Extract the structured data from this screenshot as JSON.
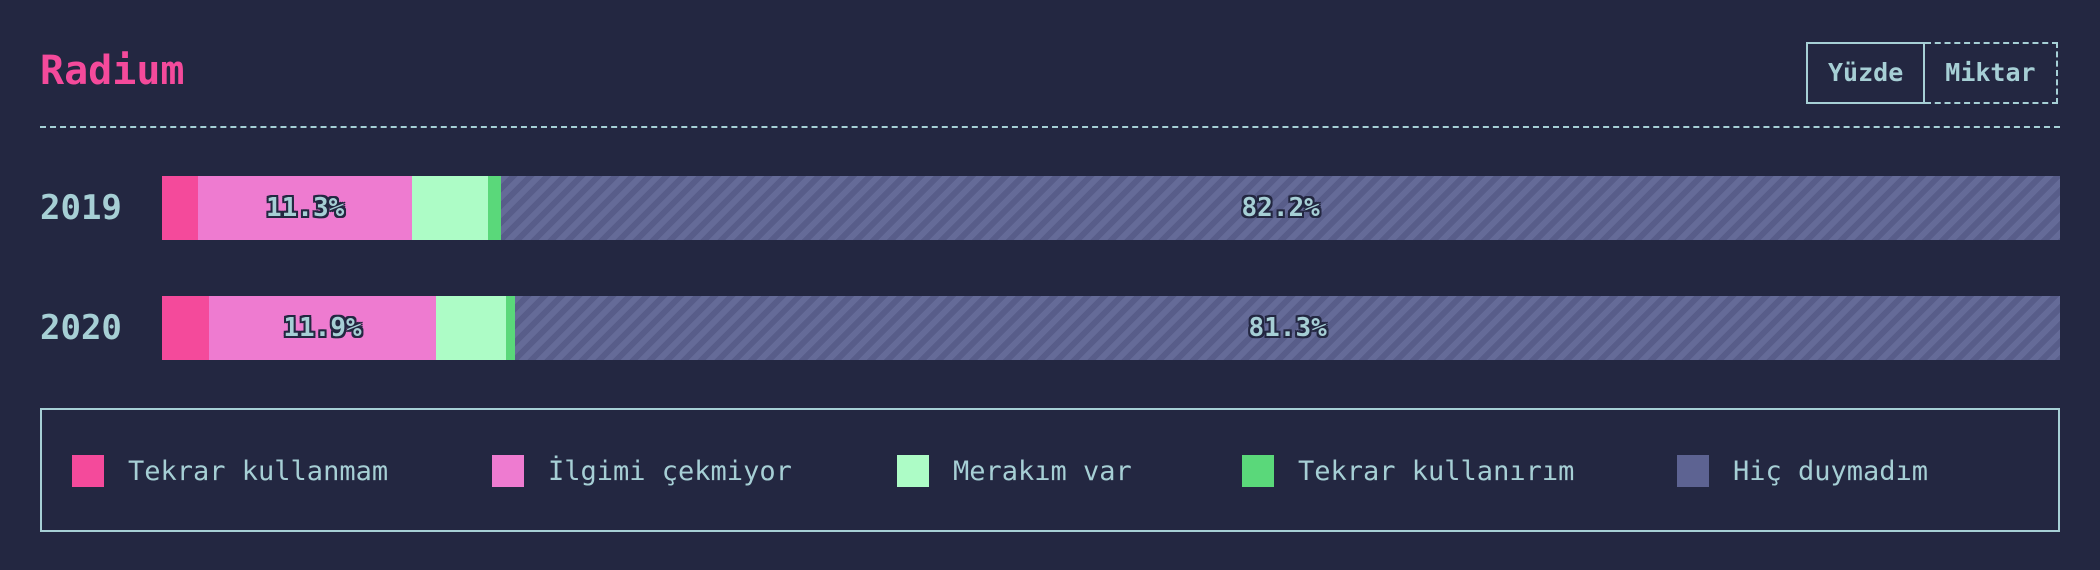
{
  "header": {
    "title": "Radium",
    "toggle": {
      "percent_label": "Yüzde",
      "amount_label": "Miktar"
    }
  },
  "colors": {
    "background": "#232741",
    "text": "#a6cfd5",
    "title": "#f44a9b"
  },
  "chart_data": {
    "type": "bar",
    "orientation": "horizontal",
    "stacked": true,
    "normalized": true,
    "categories": [
      "2019",
      "2020"
    ],
    "series": [
      {
        "name": "Tekrar kullanmam",
        "color": "#f44a9b",
        "values": [
          1.9,
          2.5
        ]
      },
      {
        "name": "İlgimi çekmiyor",
        "color": "#ee7bd0",
        "values": [
          11.3,
          11.9
        ]
      },
      {
        "name": "Merakım var",
        "color": "#adfcc6",
        "values": [
          4.0,
          3.7
        ]
      },
      {
        "name": "Tekrar kullanırım",
        "color": "#5ad87a",
        "values": [
          0.7,
          0.5
        ]
      },
      {
        "name": "Hiç duymadım",
        "color": "#5d6392",
        "values": [
          82.2,
          81.3
        ]
      }
    ],
    "value_labels": [
      [
        "",
        "11.3%",
        "",
        "",
        "82.2%"
      ],
      [
        "",
        "11.9%",
        "",
        "",
        "81.3%"
      ]
    ],
    "legend_placement": "bottom",
    "unit": "%"
  }
}
